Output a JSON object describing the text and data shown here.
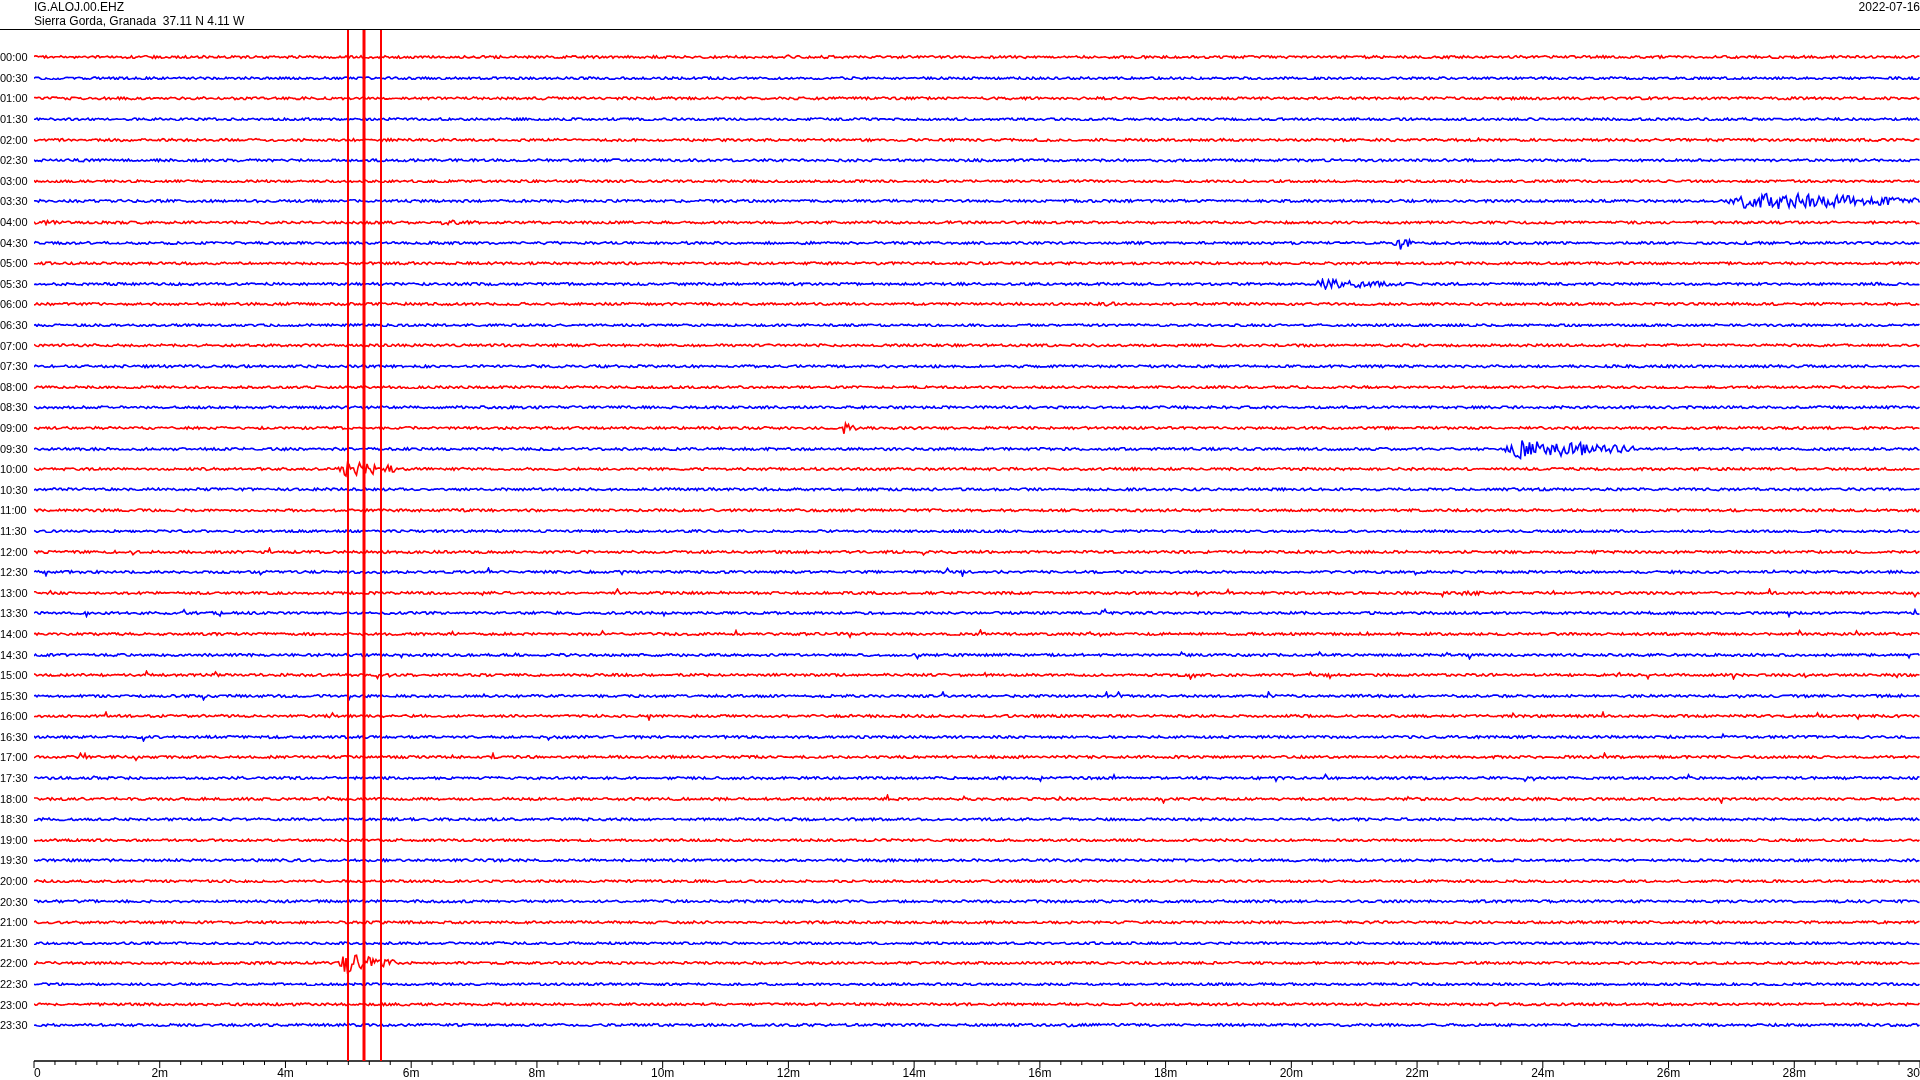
{
  "header": {
    "station": "IG.ALOJ.00.EHZ",
    "location": "Sierra Gorda, Granada  37.11 N 4.11 W",
    "date": "2022-07-16"
  },
  "rows": [
    {
      "time": "00:00",
      "color": "#ff0000"
    },
    {
      "time": "00:30",
      "color": "#0000ff"
    },
    {
      "time": "01:00",
      "color": "#ff0000"
    },
    {
      "time": "01:30",
      "color": "#0000ff"
    },
    {
      "time": "02:00",
      "color": "#ff0000"
    },
    {
      "time": "02:30",
      "color": "#0000ff"
    },
    {
      "time": "03:00",
      "color": "#ff0000"
    },
    {
      "time": "03:30",
      "color": "#0000ff"
    },
    {
      "time": "04:00",
      "color": "#ff0000"
    },
    {
      "time": "04:30",
      "color": "#0000ff"
    },
    {
      "time": "05:00",
      "color": "#ff0000"
    },
    {
      "time": "05:30",
      "color": "#0000ff"
    },
    {
      "time": "06:00",
      "color": "#ff0000"
    },
    {
      "time": "06:30",
      "color": "#0000ff"
    },
    {
      "time": "07:00",
      "color": "#ff0000"
    },
    {
      "time": "07:30",
      "color": "#0000ff"
    },
    {
      "time": "08:00",
      "color": "#ff0000"
    },
    {
      "time": "08:30",
      "color": "#0000ff"
    },
    {
      "time": "09:00",
      "color": "#ff0000"
    },
    {
      "time": "09:30",
      "color": "#0000ff"
    },
    {
      "time": "10:00",
      "color": "#ff0000"
    },
    {
      "time": "10:30",
      "color": "#0000ff"
    },
    {
      "time": "11:00",
      "color": "#ff0000"
    },
    {
      "time": "11:30",
      "color": "#0000ff"
    },
    {
      "time": "12:00",
      "color": "#ff0000"
    },
    {
      "time": "12:30",
      "color": "#0000ff"
    },
    {
      "time": "13:00",
      "color": "#ff0000"
    },
    {
      "time": "13:30",
      "color": "#0000ff"
    },
    {
      "time": "14:00",
      "color": "#ff0000"
    },
    {
      "time": "14:30",
      "color": "#0000ff"
    },
    {
      "time": "15:00",
      "color": "#ff0000"
    },
    {
      "time": "15:30",
      "color": "#0000ff"
    },
    {
      "time": "16:00",
      "color": "#ff0000"
    },
    {
      "time": "16:30",
      "color": "#0000ff"
    },
    {
      "time": "17:00",
      "color": "#ff0000"
    },
    {
      "time": "17:30",
      "color": "#0000ff"
    },
    {
      "time": "18:00",
      "color": "#ff0000"
    },
    {
      "time": "18:30",
      "color": "#0000ff"
    },
    {
      "time": "19:00",
      "color": "#ff0000"
    },
    {
      "time": "19:30",
      "color": "#0000ff"
    },
    {
      "time": "20:00",
      "color": "#ff0000"
    },
    {
      "time": "20:30",
      "color": "#0000ff"
    },
    {
      "time": "21:00",
      "color": "#ff0000"
    },
    {
      "time": "21:30",
      "color": "#0000ff"
    },
    {
      "time": "22:00",
      "color": "#ff0000"
    },
    {
      "time": "22:30",
      "color": "#0000ff"
    },
    {
      "time": "23:00",
      "color": "#ff0000"
    },
    {
      "time": "23:30",
      "color": "#0000ff"
    }
  ],
  "x_axis": {
    "ticks": [
      "0",
      "2m",
      "4m",
      "6m",
      "8m",
      "10m",
      "12m",
      "14m",
      "16m",
      "18m",
      "20m",
      "22m",
      "24m",
      "26m",
      "28m",
      "30"
    ]
  }
}
